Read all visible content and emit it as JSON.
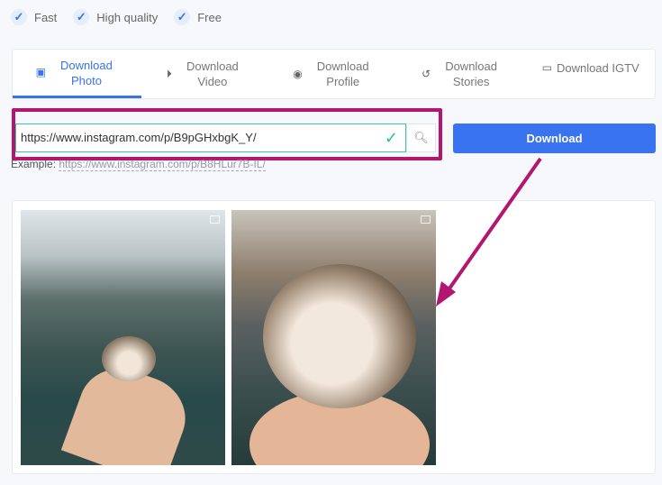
{
  "features": [
    "Fast",
    "High quality",
    "Free"
  ],
  "tabs": [
    {
      "label": "Download Photo",
      "icon": "image-icon",
      "active": true
    },
    {
      "label": "Download Video",
      "icon": "play-circle-icon"
    },
    {
      "label": "Download Profile",
      "icon": "user-circle-icon"
    },
    {
      "label": "Download Stories",
      "icon": "history-icon"
    },
    {
      "label": "Download IGTV",
      "icon": "monitor-icon"
    }
  ],
  "input": {
    "value": "https://www.instagram.com/p/B9pGHxbgK_Y/"
  },
  "download_label": "Download",
  "example": {
    "label": "Example:",
    "url": "https://www.instagram.com/p/B8HLur7B-IL/"
  },
  "colors": {
    "accent": "#3a73f0",
    "highlight": "#b3166e",
    "valid": "#2cbf96"
  }
}
